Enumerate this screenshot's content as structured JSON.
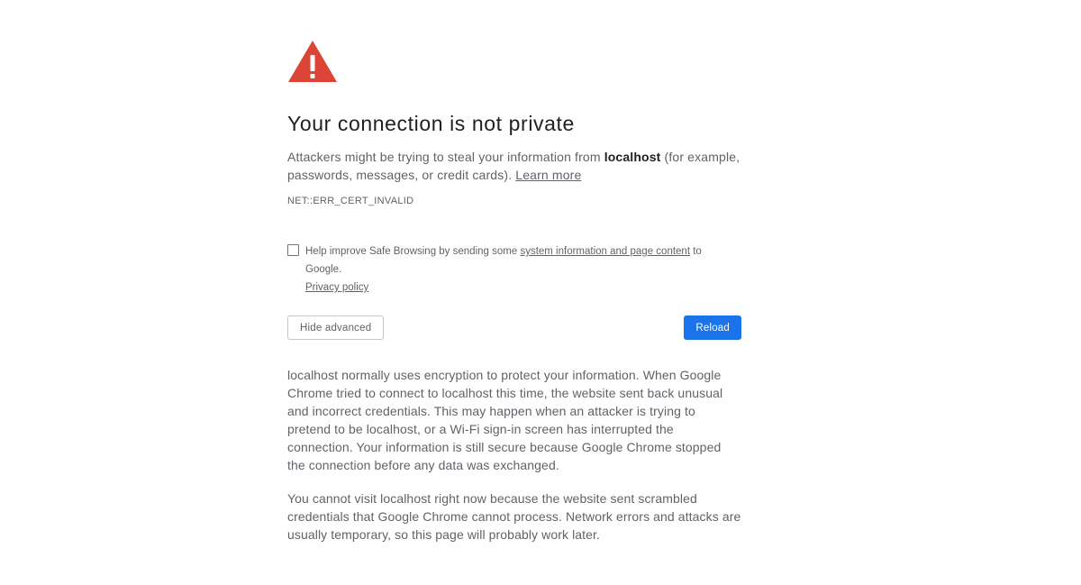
{
  "icons": {
    "warning": "warning-triangle-icon",
    "warning_color": "#db4437"
  },
  "heading": {
    "title": "Your connection is not private"
  },
  "main_message": {
    "prefix": "Attackers might be trying to steal your information from ",
    "host": "localhost",
    "suffix": " (for example, passwords, messages, or credit cards). ",
    "learn_more": "Learn more"
  },
  "error_code": "NET::ERR_CERT_INVALID",
  "optin": {
    "checked": false,
    "prefix": "Help improve Safe Browsing by sending some ",
    "link_label": "system information and page content",
    "suffix": " to Google. ",
    "privacy_label": "Privacy policy"
  },
  "buttons": {
    "hide_advanced": "Hide advanced",
    "reload": "Reload",
    "primary_color": "#1a73e8"
  },
  "details": {
    "paragraph1": "localhost normally uses encryption to protect your information. When Google Chrome tried to connect to localhost this time, the website sent back unusual and incorrect credentials. This may happen when an attacker is trying to pretend to be localhost, or a Wi-Fi sign-in screen has interrupted the connection. Your information is still secure because Google Chrome stopped the connection before any data was exchanged.",
    "paragraph2": "You cannot visit localhost right now because the website sent scrambled credentials that Google Chrome cannot process. Network errors and attacks are usually temporary, so this page will probably work later."
  }
}
